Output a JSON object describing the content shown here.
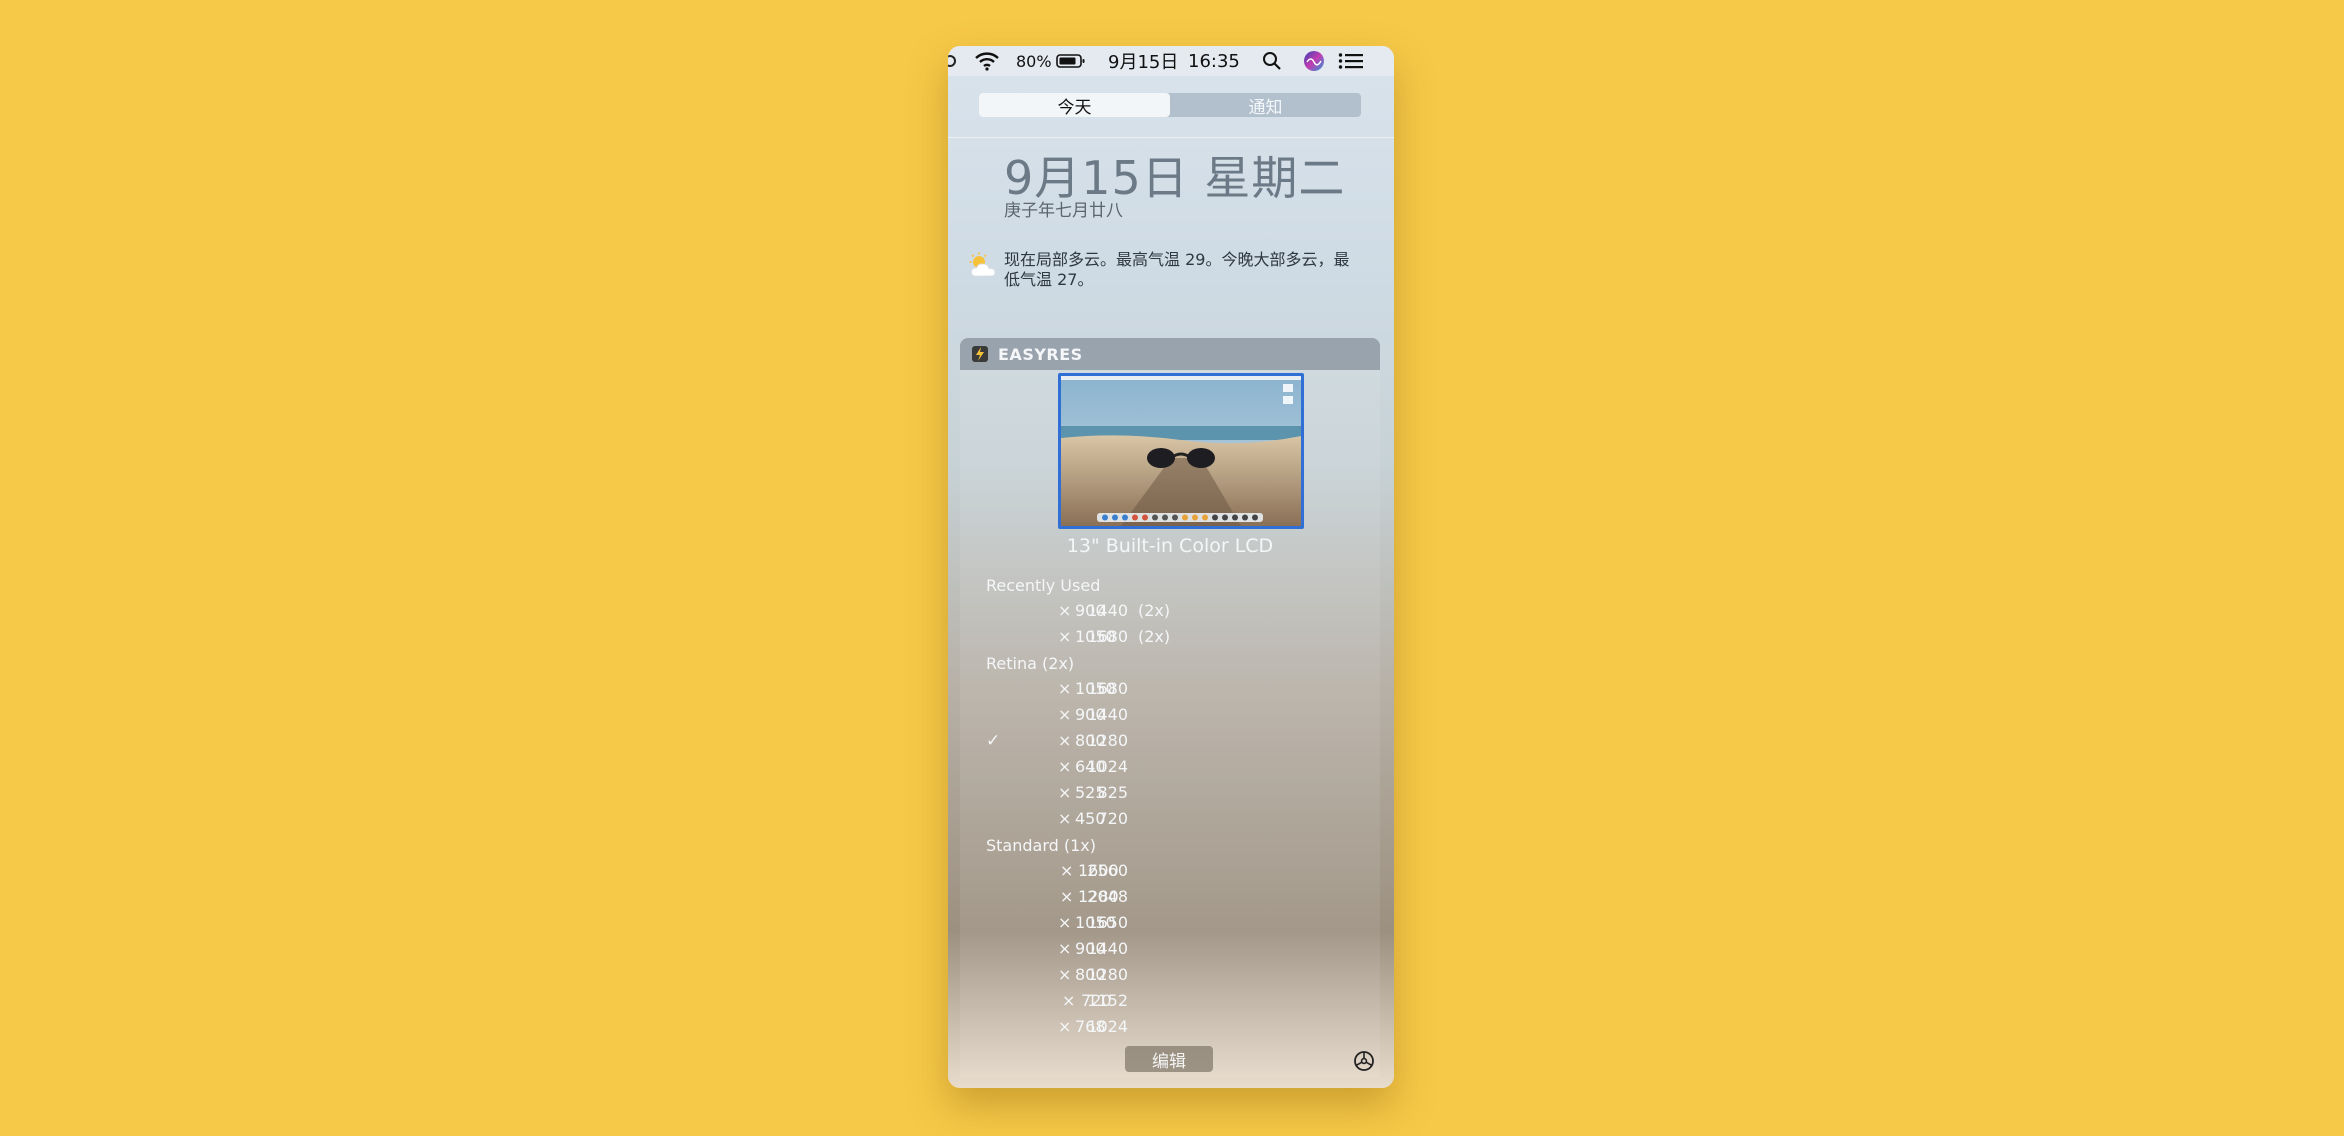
{
  "menubar": {
    "battery_percent": "80%",
    "date": "9月15日",
    "time": "16:35",
    "icons": [
      "wifi-icon",
      "battery-icon",
      "spotlight-search-icon",
      "siri-icon",
      "notification-center-icon"
    ]
  },
  "tabs": {
    "today": "今天",
    "notifications": "通知"
  },
  "date": {
    "main": "9月15日 星期二",
    "lunar": "庚子年七月廿八"
  },
  "weather": {
    "icon": "partly-cloudy-icon",
    "text": "现在局部多云。最高气温 29。今晚大部多云，最低气温 27。"
  },
  "widget": {
    "title": "EASYRES",
    "display_name": "13\" Built-in Color LCD",
    "sections": [
      {
        "label": "Recently Used",
        "items": [
          {
            "w": "1440",
            "h": "900",
            "scale": "(2x)"
          },
          {
            "w": "1680",
            "h": "1050",
            "scale": "(2x)"
          }
        ]
      },
      {
        "label": "Retina (2x)",
        "items": [
          {
            "w": "1680",
            "h": "1050"
          },
          {
            "w": "1440",
            "h": "900"
          },
          {
            "w": "1280",
            "h": "800",
            "selected": "✓"
          },
          {
            "w": "1024",
            "h": "640"
          },
          {
            "w": "825",
            "h": "525"
          },
          {
            "w": "720",
            "h": "450"
          }
        ]
      },
      {
        "label": "Standard (1x)",
        "items": [
          {
            "w": "2560",
            "h": "1600"
          },
          {
            "w": "2048",
            "h": "1280"
          },
          {
            "w": "1650",
            "h": "1050"
          },
          {
            "w": "1440",
            "h": "900"
          },
          {
            "w": "1280",
            "h": "800"
          },
          {
            "w": "1152",
            "h": "720"
          },
          {
            "w": "1024",
            "h": "768"
          }
        ]
      }
    ]
  },
  "footer": {
    "edit": "编辑"
  },
  "times_sign": "×",
  "colors": {
    "background": "#F7C948",
    "selection": "#2f6fd6"
  }
}
